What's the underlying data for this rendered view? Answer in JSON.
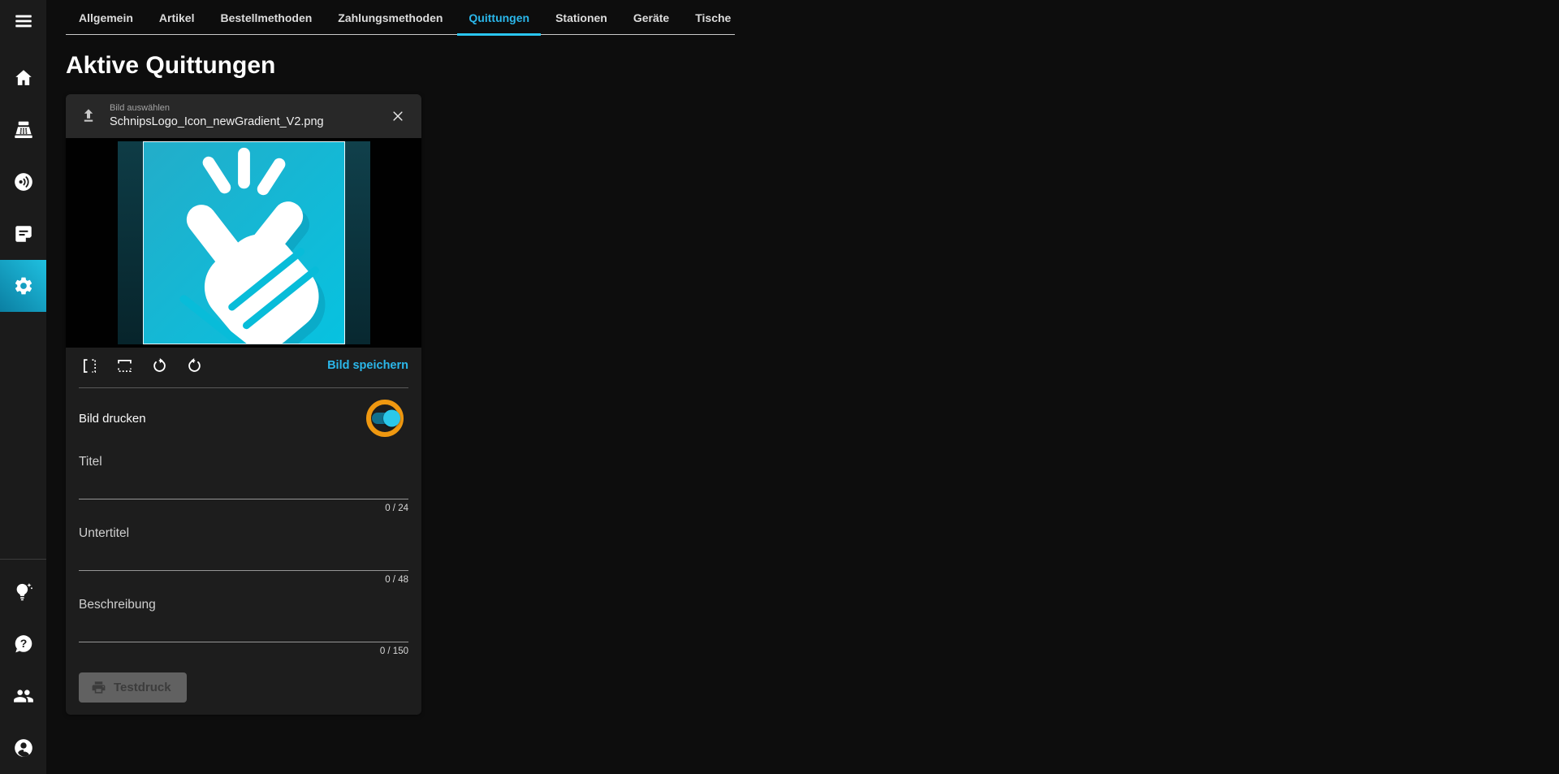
{
  "colors": {
    "accent": "#2bb7ea",
    "accent_bright": "#2ac6f0",
    "toggle_ring": "#ef9810",
    "toggle_knob": "#2bc8ea",
    "toggle_track": "#11708c"
  },
  "sidebar": {
    "items": [
      {
        "icon": "menu-icon"
      },
      {
        "icon": "home-icon"
      },
      {
        "icon": "cash-register-icon"
      },
      {
        "icon": "contactless-icon"
      },
      {
        "icon": "receipt-note-icon"
      },
      {
        "icon": "settings-gear-icon",
        "active": true
      },
      {
        "icon": "tips-lightbulb-icon"
      },
      {
        "icon": "help-icon"
      },
      {
        "icon": "users-icon"
      },
      {
        "icon": "account-icon"
      }
    ]
  },
  "tabs": {
    "items": [
      {
        "label": "Allgemein"
      },
      {
        "label": "Artikel"
      },
      {
        "label": "Bestellmethoden"
      },
      {
        "label": "Zahlungsmethoden"
      },
      {
        "label": "Quittungen",
        "active": true
      },
      {
        "label": "Stationen"
      },
      {
        "label": "Geräte"
      },
      {
        "label": "Tische"
      }
    ]
  },
  "page": {
    "title": "Aktive Quittungen"
  },
  "uploader": {
    "label": "Bild auswählen",
    "filename": "SchnipsLogo_Icon_newGradient_V2.png",
    "save_label": "Bild speichern",
    "tools": [
      "flip-horizontal",
      "flip-vertical",
      "rotate-right",
      "rotate-left"
    ]
  },
  "print_image": {
    "label": "Bild drucken",
    "enabled": true
  },
  "fields": [
    {
      "label": "Titel",
      "value": "",
      "counter": "0 / 24",
      "max": 24
    },
    {
      "label": "Untertitel",
      "value": "",
      "counter": "0 / 48",
      "max": 48
    },
    {
      "label": "Beschreibung",
      "value": "",
      "counter": "0 / 150",
      "max": 150
    }
  ],
  "test_print": {
    "label": "Testdruck",
    "disabled": true
  }
}
